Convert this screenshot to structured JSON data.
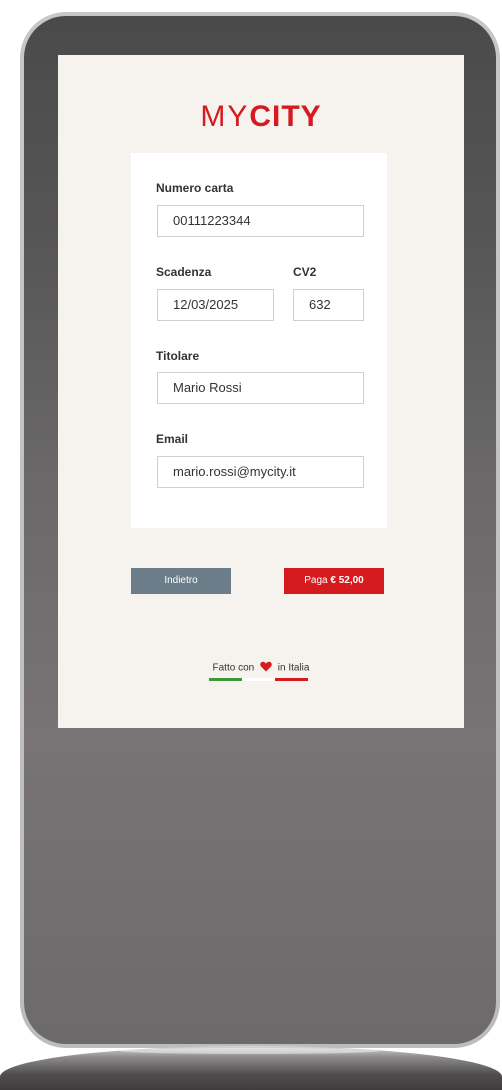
{
  "logo": {
    "my": "MY",
    "city": "CITY"
  },
  "form": {
    "card_number_label": "Numero carta",
    "card_number_value": "00111223344",
    "expiry_label": "Scadenza",
    "expiry_value": "12/03/2025",
    "cv2_label": "CV2",
    "cv2_value": "632",
    "holder_label": "Titolare",
    "holder_value": "Mario Rossi",
    "email_label": "Email",
    "email_value": "mario.rossi@mycity.it"
  },
  "buttons": {
    "back_label": "Indietro",
    "pay_prefix": "Paga",
    "pay_amount": "€ 52,00"
  },
  "footer": {
    "made_with": "Fatto con",
    "in_italy": "in Italia"
  },
  "icons": {
    "heart": "heart-icon"
  },
  "colors": {
    "brand_red": "#d51b1f",
    "back_button": "#6b7d88",
    "flag_green": "#3a9a3a",
    "flag_white": "#ffffff",
    "flag_red": "#d51b1f"
  }
}
